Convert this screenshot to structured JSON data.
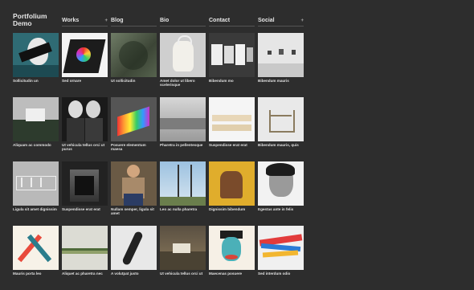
{
  "brand": {
    "line1": "Portfolium",
    "line2": "Demo"
  },
  "nav": [
    {
      "label": "Works",
      "chevron": true
    },
    {
      "label": "Blog",
      "chevron": false
    },
    {
      "label": "Bio",
      "chevron": false
    },
    {
      "label": "Contact",
      "chevron": false
    },
    {
      "label": "Social",
      "chevron": true
    }
  ],
  "tiles": [
    {
      "caption": "Sollicitudin un"
    },
    {
      "caption": "Sed ornare"
    },
    {
      "caption": "Ut sollicitudin"
    },
    {
      "caption": "Amet dolor ut libero scelerisque"
    },
    {
      "caption": "Bibendum mo"
    },
    {
      "caption": "Bibendum mauris"
    },
    {
      "caption": "Aliquam ac commodo"
    },
    {
      "caption": "Ut vehicula tellus orci ut purus"
    },
    {
      "caption": "Posuere elementum maesa"
    },
    {
      "caption": "Pharetra in pellentesque"
    },
    {
      "caption": "Suspendisse erat erat"
    },
    {
      "caption": "Bibendum mauris, quis"
    },
    {
      "caption": "Ligula sit amet dignissim"
    },
    {
      "caption": "Suspendisse erat erat"
    },
    {
      "caption": "Nullam semper, ligula sit amet"
    },
    {
      "caption": "Leo ac nulla pharetra"
    },
    {
      "caption": "Dignissim bibendum"
    },
    {
      "caption": "Egestas ante in felis"
    },
    {
      "caption": "Mauris porta leo"
    },
    {
      "caption": "Aliquet ac pharetra nec"
    },
    {
      "caption": "A volutpat justo"
    },
    {
      "caption": "Ut vehicula tellus orci ut"
    },
    {
      "caption": "Maecenas posuere"
    },
    {
      "caption": "Sed interdum odio"
    }
  ]
}
